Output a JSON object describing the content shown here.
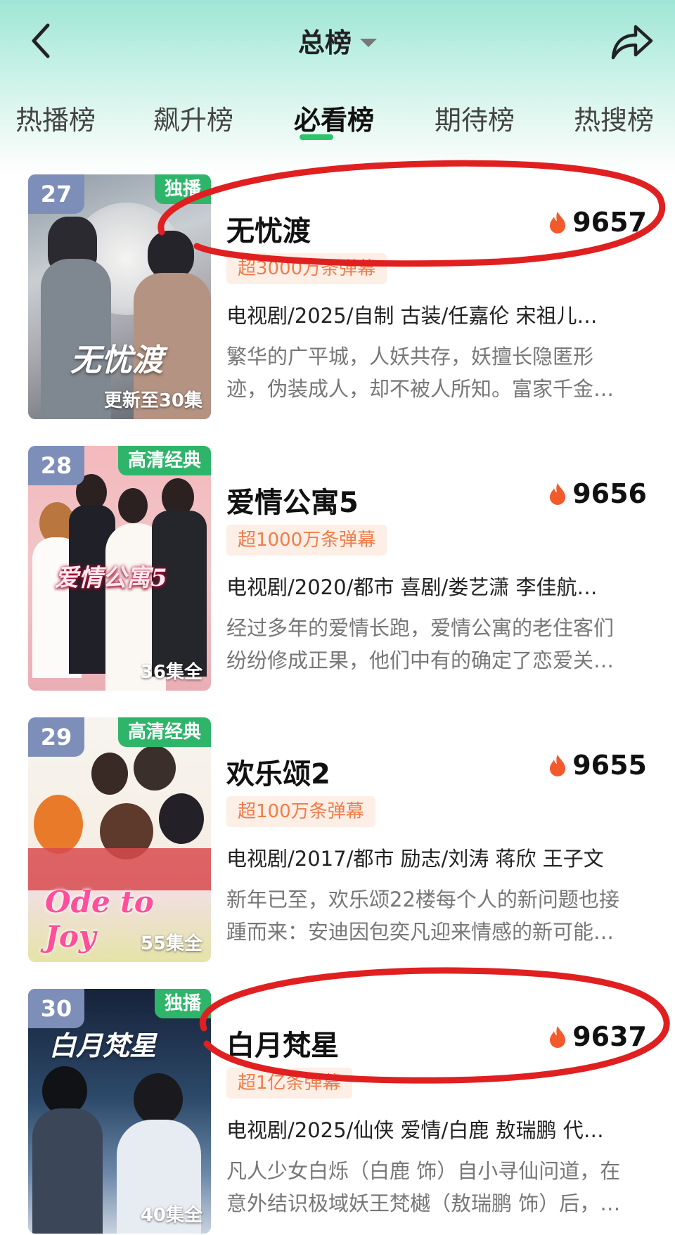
{
  "header": {
    "title": "总榜"
  },
  "tabs": [
    "热播榜",
    "飙升榜",
    "必看榜",
    "期待榜",
    "热搜榜"
  ],
  "active_tab": "必看榜",
  "colors": {
    "accent_green": "#2fb56a",
    "danmu_text": "#ee7d4a",
    "danmu_bg": "#fdeee6",
    "heat_red": "#f25a2c",
    "highlight_circle": "#e02020"
  },
  "items": [
    {
      "rank": "27",
      "badge": "独播",
      "episodes": "更新至30集",
      "poster_title": "无忧渡",
      "title": "无忧渡",
      "heat": "9657",
      "danmu": "超3000万条弹幕",
      "meta": "电视剧/2025/自制 古装/任嘉伦 宋祖儿…",
      "desc1": "繁华的广平城，人妖共存，妖擅长隐匿形",
      "desc2": "迹，伪装成人，却不被人所知。富家千金…",
      "highlighted": true
    },
    {
      "rank": "28",
      "badge": "高清经典",
      "episodes": "36集全",
      "poster_title": "爱情公寓5",
      "title": "爱情公寓5",
      "heat": "9656",
      "danmu": "超1000万条弹幕",
      "meta": "电视剧/2020/都市 喜剧/娄艺潇 李佳航…",
      "desc1": "经过多年的爱情长跑，爱情公寓的老住客们",
      "desc2": "纷纷修成正果，他们中有的确定了恋爱关…",
      "highlighted": false
    },
    {
      "rank": "29",
      "badge": "高清经典",
      "episodes": "55集全",
      "poster_title": "Ode to Joy",
      "title": "欢乐颂2",
      "heat": "9655",
      "danmu": "超100万条弹幕",
      "meta": "电视剧/2017/都市 励志/刘涛 蒋欣 王子文",
      "desc1": "新年已至，欢乐颂22楼每个人的新问题也接",
      "desc2": "踵而来：安迪因包奕凡迎来情感的新可能…",
      "highlighted": false
    },
    {
      "rank": "30",
      "badge": "独播",
      "episodes": "40集全",
      "poster_title": "白月梵星",
      "title": "白月梵星",
      "heat": "9637",
      "danmu": "超1亿条弹幕",
      "meta": "电视剧/2025/仙侠 爱情/白鹿 敖瑞鹏 代…",
      "desc1": "凡人少女白烁（白鹿 饰）自小寻仙问道，在",
      "desc2": "意外结识极域妖王梵樾（敖瑞鹏 饰）后，…",
      "highlighted": true
    }
  ]
}
